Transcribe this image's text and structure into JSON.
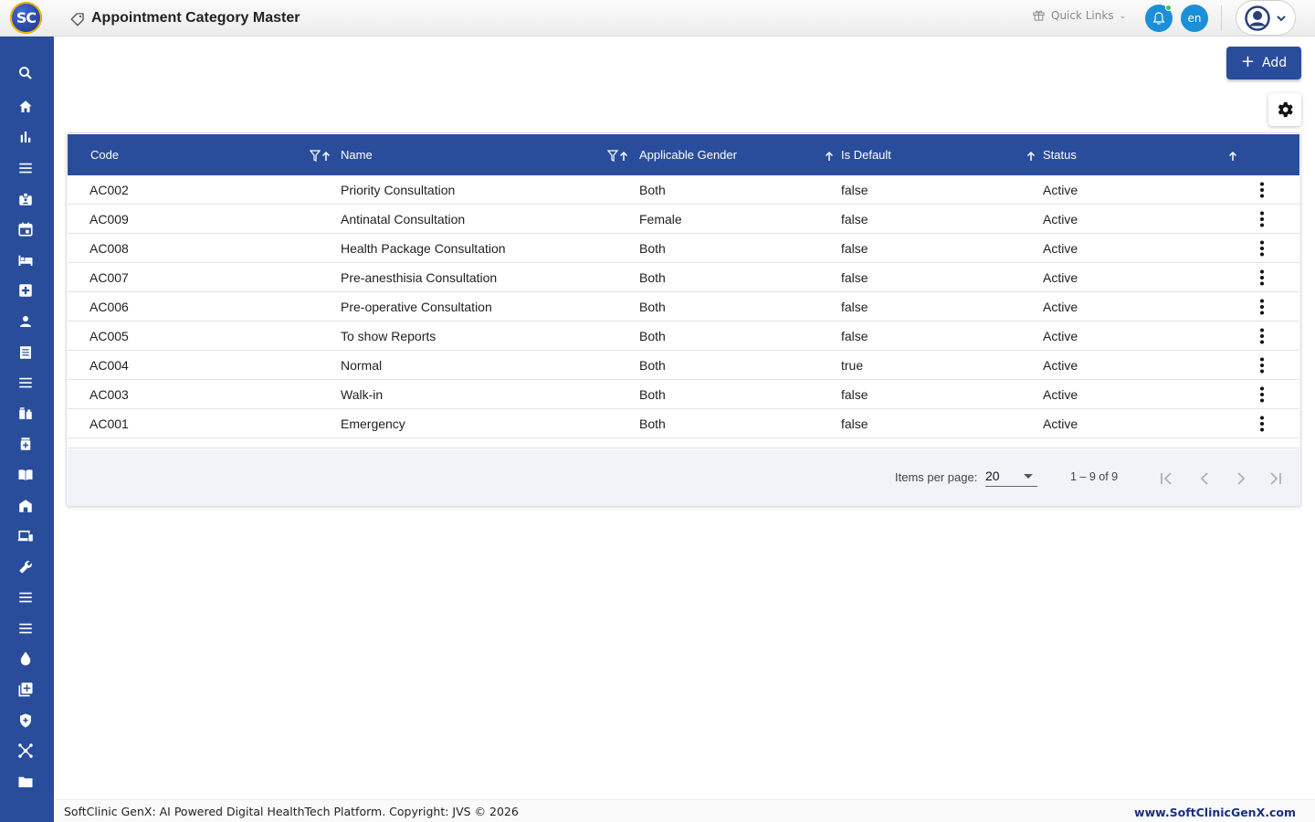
{
  "header": {
    "logo_text": "SC",
    "title": "Appointment Category Master",
    "quick_links_label": "Quick Links",
    "lang_label": "en",
    "brand_color": "#2a4d9b",
    "accent_color": "#1b8fd8"
  },
  "sidebar": {
    "items": [
      {
        "icon": "search-icon"
      },
      {
        "icon": "home-icon"
      },
      {
        "icon": "bar-chart-icon"
      },
      {
        "icon": "menu-icon"
      },
      {
        "icon": "badge-icon"
      },
      {
        "icon": "calendar-icon"
      },
      {
        "icon": "bed-icon"
      },
      {
        "icon": "medical-plus-icon"
      },
      {
        "icon": "person-icon"
      },
      {
        "icon": "receipt-icon"
      },
      {
        "icon": "menu-icon"
      },
      {
        "icon": "vaccine-icon"
      },
      {
        "icon": "medicine-icon"
      },
      {
        "icon": "book-icon"
      },
      {
        "icon": "store-icon"
      },
      {
        "icon": "devices-icon"
      },
      {
        "icon": "wrench-icon"
      },
      {
        "icon": "menu-icon"
      },
      {
        "icon": "menu-icon"
      },
      {
        "icon": "blood-drop-icon"
      },
      {
        "icon": "library-add-icon"
      },
      {
        "icon": "shield-icon"
      },
      {
        "icon": "hub-icon"
      },
      {
        "icon": "folder-icon"
      }
    ]
  },
  "actions": {
    "add_label": "Add"
  },
  "table": {
    "columns": [
      "Code",
      "Name",
      "Applicable Gender",
      "Is Default",
      "Status"
    ],
    "rows": [
      {
        "code": "AC002",
        "name": "Priority Consultation",
        "gender": "Both",
        "is_default": "false",
        "status": "Active"
      },
      {
        "code": "AC009",
        "name": "Antinatal Consultation",
        "gender": "Female",
        "is_default": "false",
        "status": "Active"
      },
      {
        "code": "AC008",
        "name": "Health Package Consultation",
        "gender": "Both",
        "is_default": "false",
        "status": "Active"
      },
      {
        "code": "AC007",
        "name": "Pre-anesthisia Consultation",
        "gender": "Both",
        "is_default": "false",
        "status": "Active"
      },
      {
        "code": "AC006",
        "name": "Pre-operative Consultation",
        "gender": "Both",
        "is_default": "false",
        "status": "Active"
      },
      {
        "code": "AC005",
        "name": "To show Reports",
        "gender": "Both",
        "is_default": "false",
        "status": "Active"
      },
      {
        "code": "AC004",
        "name": "Normal",
        "gender": "Both",
        "is_default": "true",
        "status": "Active"
      },
      {
        "code": "AC003",
        "name": "Walk-in",
        "gender": "Both",
        "is_default": "false",
        "status": "Active"
      },
      {
        "code": "AC001",
        "name": "Emergency",
        "gender": "Both",
        "is_default": "false",
        "status": "Active"
      }
    ]
  },
  "paginator": {
    "items_per_page_label": "Items per page:",
    "page_size": "20",
    "range_label": "1 – 9 of 9"
  },
  "footer": {
    "left_text": "SoftClinic GenX: AI Powered Digital HealthTech Platform. Copyright: JVS © 2026",
    "right_text": "www.SoftClinicGenX.com"
  }
}
